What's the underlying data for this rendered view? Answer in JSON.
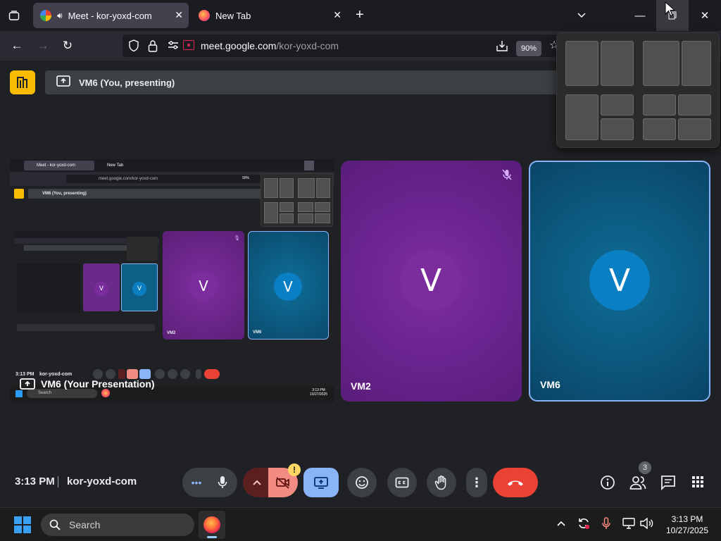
{
  "browser": {
    "tabs": [
      {
        "title": "Meet - kor-yoxd-com",
        "active": true
      },
      {
        "title": "New Tab",
        "active": false
      }
    ],
    "url_domain": "meet.google.com",
    "url_path": "/kor-yoxd-com",
    "zoom": "90%"
  },
  "meet": {
    "presenting_banner": "VM6 (You, presenting)",
    "presentation_label": "VM6 (Your Presentation)",
    "participants": [
      {
        "name": "VM2",
        "initial": "V",
        "color": "#7b2d9e"
      },
      {
        "name": "VM6",
        "initial": "V",
        "color": "#0b7fc4"
      }
    ],
    "time": "3:13 PM",
    "meeting_code": "kor-yoxd-com",
    "people_count": "3",
    "warning_badge": "!"
  },
  "mini_share": {
    "tabs": [
      "Meet - kor-yoxd-com",
      "New Tab"
    ],
    "url": "meet.google.com/kor-yoxd-com",
    "zoom": "90%",
    "banner": "VM6 (You, presenting)",
    "presentation_label": "VM6 (Your Presentation)",
    "time": "3:13 PM",
    "meeting_code": "kor-yoxd-com",
    "tiles": [
      {
        "name": "VM2",
        "initial": "V"
      },
      {
        "name": "VM6",
        "initial": "V"
      }
    ],
    "search": "Search",
    "clock_time": "3:13 PM",
    "clock_date": "10/27/2025"
  },
  "taskbar": {
    "search_placeholder": "Search",
    "clock_time": "3:13 PM",
    "clock_date": "10/27/2025"
  },
  "colors": {
    "end_call": "#ea4335",
    "present_active": "#8ab4f8",
    "camera_off": "#f28b82",
    "accent_logo": "#fbbc04"
  }
}
